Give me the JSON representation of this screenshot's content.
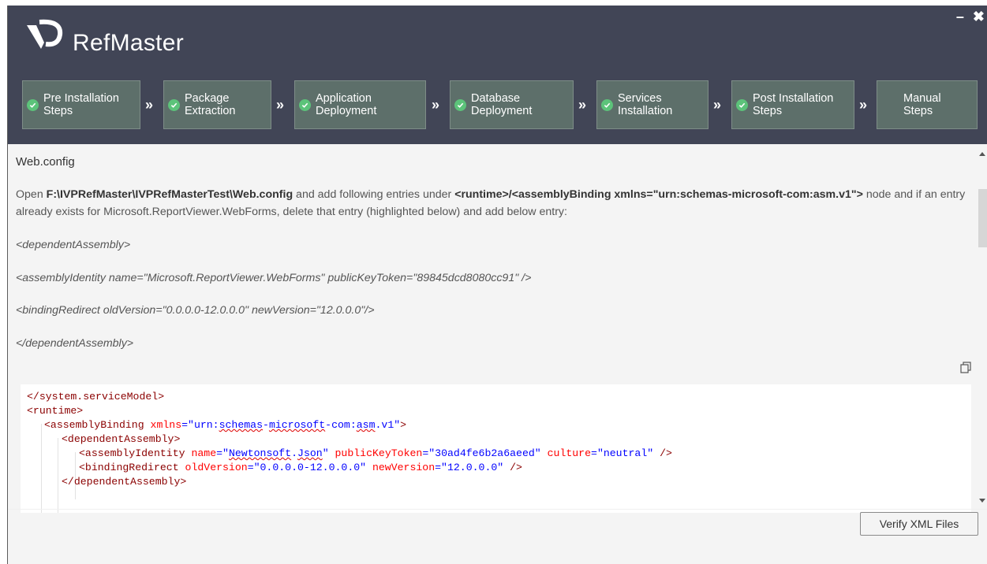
{
  "app": {
    "title": "RefMaster"
  },
  "window_controls": {
    "minimize": "–",
    "close": "✖"
  },
  "steps": [
    {
      "label": "Pre Installation Steps",
      "complete": true
    },
    {
      "label": "Package Extraction",
      "complete": true
    },
    {
      "label": "Application Deployment",
      "complete": true
    },
    {
      "label": "Database Deployment",
      "complete": true
    },
    {
      "label": "Services Installation",
      "complete": true
    },
    {
      "label": "Post Installation Steps",
      "complete": true
    },
    {
      "label": "Manual Steps",
      "complete": false
    }
  ],
  "step_separator": "»",
  "section": {
    "title": "Web.config",
    "intro_open": "Open ",
    "path": "F:\\IVPRefMaster\\IVPRefMasterTest\\Web.config",
    "intro_mid": " and add following entries under ",
    "node": "<runtime>/<assemblyBinding xmlns=\"urn:schemas-microsoft-com:asm.v1\">",
    "intro_end": " node and if an entry already exists for Microsoft.ReportViewer.WebForms, delete that entry (highlighted below) and add below entry:",
    "entries": [
      "<dependentAssembly>",
      "<assemblyIdentity name=\"Microsoft.ReportViewer.WebForms\" publicKeyToken=\"89845dcd8080cc91\" />",
      "<bindingRedirect oldVersion=\"0.0.0.0-12.0.0.0\" newVersion=\"12.0.0.0\"/>",
      "</dependentAssembly>"
    ]
  },
  "code": {
    "line1": "</system.serviceModel>",
    "line2": "<runtime>",
    "line3_tag": "<assemblyBinding",
    "line3_attr": " xmlns",
    "line3_eq": "=",
    "line3_val_a": "\"urn:",
    "line3_val_b": "schemas",
    "line3_val_c": "-",
    "line3_val_d": "microsoft",
    "line3_val_e": "-com:",
    "line3_val_f": "asm",
    "line3_val_g": ".v1\"",
    "line3_close": ">",
    "line4": "<dependentAssembly>",
    "line5_tag": "<assemblyIdentity",
    "line5_a1": " name",
    "line5_v1a": "\"",
    "line5_v1b": "Newtonsoft",
    "line5_v1c": ".",
    "line5_v1d": "Json",
    "line5_v1e": "\"",
    "line5_a2": " publicKeyToken",
    "line5_v2": "\"30ad4fe6b2a6aeed\"",
    "line5_a3": " culture",
    "line5_v3": "\"neutral\"",
    "line5_close": " />",
    "line6_tag": "<bindingRedirect",
    "line6_a1": " oldVersion",
    "line6_v1": "\"0.0.0.0-12.0.0.0\"",
    "line6_a2": " newVersion",
    "line6_v2": "\"12.0.0.0\"",
    "line6_close": " />",
    "line7": "</dependentAssembly>"
  },
  "buttons": {
    "verify": "Verify XML Files"
  },
  "colors": {
    "header_bg": "#414556",
    "step_bg": "#5d6f6a",
    "check_green": "#5cc37a",
    "xml_tag": "#8b0000",
    "xml_attr": "#ff0000",
    "xml_value": "#0000ff"
  }
}
